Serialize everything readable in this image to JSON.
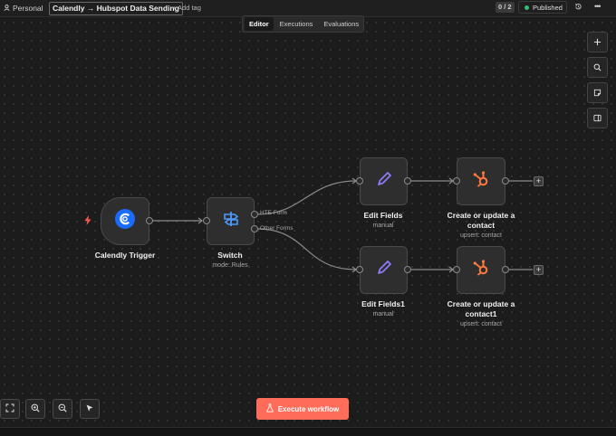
{
  "header": {
    "project": "Personal",
    "workflow_name": "Calendly → Hubspot Data Sending",
    "add_tag": "+ Add tag",
    "counter": "0 / 2",
    "status": "Published"
  },
  "tabs": [
    {
      "label": "Editor",
      "active": true
    },
    {
      "label": "Executions",
      "active": false
    },
    {
      "label": "Evaluations",
      "active": false
    }
  ],
  "right_toolbar": [
    "plus-icon",
    "search-icon",
    "sticky-note-icon",
    "panel-toggle-icon"
  ],
  "nodes": {
    "calendly": {
      "title": "Calendly Trigger"
    },
    "switch": {
      "title": "Switch",
      "subtitle": "mode: Rules",
      "out1": "HTE Form",
      "out2": "Other Forms"
    },
    "edit1": {
      "title": "Edit Fields",
      "subtitle": "manual"
    },
    "hub1": {
      "title": "Create or update a contact",
      "subtitle": "upsert: contact"
    },
    "edit2": {
      "title": "Edit Fields1",
      "subtitle": "manual"
    },
    "hub2": {
      "title": "Create or update a contact1",
      "subtitle": "upsert: contact"
    }
  },
  "bottom_toolbar": [
    "fit-view-icon",
    "zoom-in-icon",
    "zoom-out-icon",
    "select-pointer-icon"
  ],
  "execute_button": "Execute workflow",
  "colors": {
    "accent": "#ff6d5a",
    "published_dot": "#2fbf71",
    "calendly_blue": "#1a6cff",
    "hubspot_orange": "#ff7a3d",
    "edit_purple": "#8f7cf5",
    "switch_blue": "#4b9bff"
  }
}
